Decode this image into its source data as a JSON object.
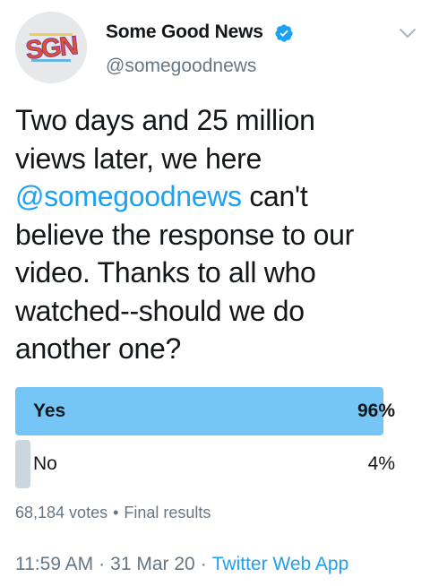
{
  "author": {
    "name": "Some Good News",
    "handle": "@somegoodnews",
    "avatar_logo_text": "SGN",
    "verified": true
  },
  "tweet": {
    "text_line1": "Two days and 25 million",
    "text_line2": "views later, we here",
    "mention": "@somegoodnews",
    "text_line3_rest": " can't",
    "text_line4": "believe the response to our",
    "text_line5": "video. Thanks to all who",
    "text_line6": "watched--should we do",
    "text_line7": "another one?"
  },
  "poll": {
    "options": [
      {
        "label": "Yes",
        "percent_text": "96%",
        "fraction": 0.96,
        "winner": true
      },
      {
        "label": "No",
        "percent_text": "4%",
        "fraction": 0.04,
        "winner": false
      }
    ],
    "votes": "68,184 votes",
    "meta_separator": "•",
    "status": "Final results"
  },
  "footer": {
    "time": "11:59 AM",
    "separator": "·",
    "date": "31 Mar 20",
    "source": "Twitter Web App"
  },
  "colors": {
    "link": "#1da1f2",
    "winner_bar": "#75c6f6",
    "loser_bar": "#ccd6dd",
    "secondary_text": "#657786",
    "primary_text": "#14171a"
  },
  "icons": {
    "verified": "verified-badge-icon",
    "menu": "chevron-down-icon"
  }
}
